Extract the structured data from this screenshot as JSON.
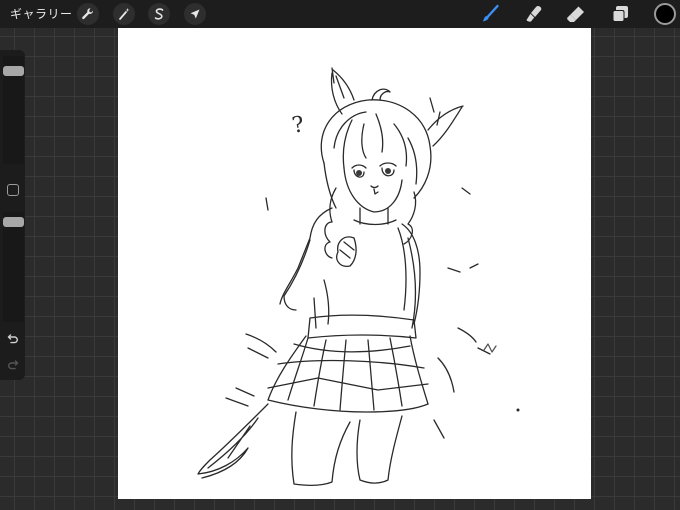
{
  "topbar": {
    "gallery_label": "ギャラリー",
    "left_tools": [
      {
        "icon": "wrench-icon",
        "name": "actions-button"
      },
      {
        "icon": "magic-wand-icon",
        "name": "adjustments-button"
      },
      {
        "icon": "selection-s-icon",
        "name": "selection-button"
      },
      {
        "icon": "arrow-cursor-icon",
        "name": "transform-button"
      }
    ],
    "right_tools": [
      {
        "icon": "brush-icon",
        "name": "brush-button",
        "active": true
      },
      {
        "icon": "smudge-icon",
        "name": "smudge-button"
      },
      {
        "icon": "eraser-icon",
        "name": "eraser-button"
      },
      {
        "icon": "layers-icon",
        "name": "layers-button"
      }
    ],
    "current_color": "#000000",
    "active_tool_color": "#3b8ff5"
  },
  "sidebar": {
    "brush_size": 0.9,
    "opacity": 0.95,
    "undo_icon": "undo-icon",
    "redo_icon": "redo-icon",
    "modify_icon": "square-icon"
  },
  "canvas": {
    "background": "#ffffff",
    "sketch_text": "?"
  }
}
